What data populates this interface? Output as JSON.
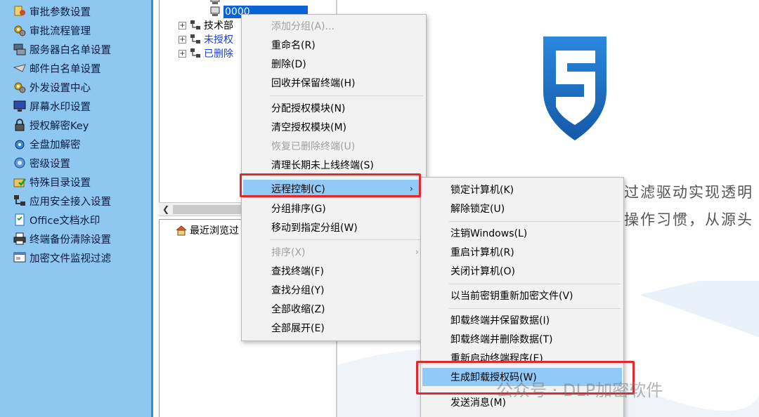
{
  "left_nav": {
    "items": [
      {
        "label": "审批参数设置",
        "icon": "approval-settings-icon"
      },
      {
        "label": "审批流程管理",
        "icon": "gears-icon"
      },
      {
        "label": "服务器白名单设置",
        "icon": "server-icon"
      },
      {
        "label": "邮件白名单设置",
        "icon": "mail-icon"
      },
      {
        "label": "外发设置中心",
        "icon": "gears-icon"
      },
      {
        "label": "屏幕水印设置",
        "icon": "monitor-icon"
      },
      {
        "label": "授权解密Key",
        "icon": "lock-icon"
      },
      {
        "label": "全盘加解密",
        "icon": "disk-icon"
      },
      {
        "label": "密级设置",
        "icon": "gear-blue-icon"
      },
      {
        "label": "特殊目录设置",
        "icon": "folder-check-icon"
      },
      {
        "label": "应用安全接入设置",
        "icon": "network-icon"
      },
      {
        "label": "Office文档水印",
        "icon": "document-icon"
      },
      {
        "label": "终端备份清除设置",
        "icon": "printer-icon"
      },
      {
        "label": "加密文件监视过滤",
        "icon": "filter-window-icon"
      }
    ]
  },
  "tree": {
    "selected_node": "0000",
    "nodes": [
      {
        "label": "技术部",
        "color": "#000000"
      },
      {
        "label": "未授权",
        "color": "#1a3fd6"
      },
      {
        "label": "已删除",
        "color": "#1a3fd6"
      }
    ],
    "recent_browse": "最近浏览过"
  },
  "context_menu": {
    "items": [
      {
        "label": "添加分组(A)...",
        "disabled": true
      },
      {
        "label": "重命名(R)",
        "disabled": false
      },
      {
        "label": "删除(D)",
        "disabled": false
      },
      {
        "label": "回收并保留终端(H)",
        "disabled": false
      },
      {
        "label": "分配授权模块(N)",
        "disabled": false
      },
      {
        "label": "清空授权模块(M)",
        "disabled": false
      },
      {
        "label": "恢复已删除终端(U)",
        "disabled": true
      },
      {
        "label": "清理长期未上线终端(S)",
        "disabled": false
      },
      {
        "label": "远程控制(C)",
        "disabled": false,
        "submenu": true,
        "highlighted": true
      },
      {
        "label": "分组排序(G)",
        "disabled": false
      },
      {
        "label": "移动到指定分组(W)",
        "disabled": false
      },
      {
        "label": "排序(X)",
        "disabled": true,
        "submenu": true
      },
      {
        "label": "查找终端(F)",
        "disabled": false
      },
      {
        "label": "查找分组(Y)",
        "disabled": false
      },
      {
        "label": "全部收缩(Z)",
        "disabled": false
      },
      {
        "label": "全部展开(E)",
        "disabled": false
      }
    ]
  },
  "submenu": {
    "items": [
      {
        "label": "锁定计算机(K)"
      },
      {
        "label": "解除锁定(U)"
      },
      {
        "label": "注销Windows(L)"
      },
      {
        "label": "重启计算机(R)"
      },
      {
        "label": "关闭计算机(O)"
      },
      {
        "label": "以当前密钥重新加密文件(V)"
      },
      {
        "label": "卸载终端并保留数据(I)"
      },
      {
        "label": "卸载终端并删除数据(T)"
      },
      {
        "label": "重新启动终端程序(E)"
      },
      {
        "label": "生成卸载授权码(W)",
        "highlighted": true
      },
      {
        "label": "发送消息(M)"
      }
    ]
  },
  "content": {
    "line1": "过滤驱动实现透明",
    "line2": "操作习惯，从源头"
  },
  "watermark": "公众号 · DLP加密软件",
  "colors": {
    "nav_bg": "#8ec8f0",
    "menu_highlight": "#91c9f7",
    "annotation_red": "#e0282d",
    "logo_blue": "#1e6fc8"
  }
}
